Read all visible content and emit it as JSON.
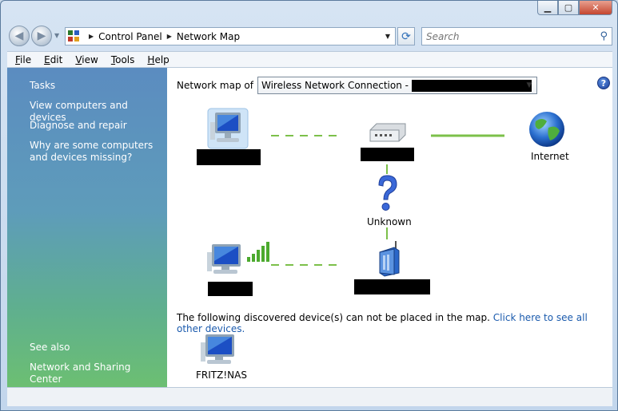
{
  "window": {
    "caption_buttons": [
      "minimize",
      "maximize",
      "close"
    ]
  },
  "address": {
    "breadcrumbs": [
      "Control Panel",
      "Network Map"
    ]
  },
  "search": {
    "placeholder": "Search"
  },
  "menu": [
    "File",
    "Edit",
    "View",
    "Tools",
    "Help"
  ],
  "sidebar": {
    "heading": "Tasks",
    "tasks": [
      "View computers and devices",
      "Diagnose and repair",
      "Why are some computers and devices missing?"
    ],
    "see_also_heading": "See also",
    "see_also": [
      "Network and Sharing Center"
    ]
  },
  "map": {
    "label": "Network map of",
    "connection_prefix": "Wireless Network Connection -",
    "internet_label": "Internet",
    "unknown_label": "Unknown",
    "undiscovered_text": "The following discovered device(s) can not be placed in the map.",
    "undiscovered_link": "Click here to see all other devices.",
    "nas_label": "FRITZ!NAS"
  },
  "icons": [
    "back-icon",
    "forward-icon",
    "control-panel-icon",
    "refresh-icon",
    "search-icon",
    "help-icon",
    "computer-icon",
    "switch-icon",
    "globe-icon",
    "question-icon",
    "wireless-computer-icon",
    "wireless-router-icon"
  ],
  "colors": {
    "link": "#1a5aad",
    "wired_link": "#7cc04a",
    "sidebar_top": "#5b8cc0",
    "sidebar_bottom": "#6cbf72"
  }
}
